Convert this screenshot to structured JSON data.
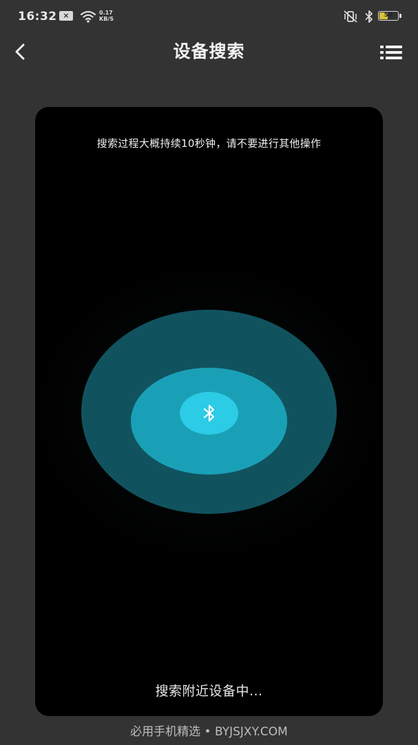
{
  "status_bar": {
    "time": "16:32",
    "notification_badge": "×",
    "net_speed_value": "0.17",
    "net_speed_unit": "KB/S",
    "battery_level": "50",
    "icons": [
      "close-notification-icon",
      "wifi-icon",
      "vibrate-off-icon",
      "bluetooth-icon",
      "battery-icon"
    ]
  },
  "header": {
    "title": "设备搜索",
    "back_icon": "chevron-left-icon",
    "menu_icon": "list-menu-icon"
  },
  "search": {
    "hint": "搜索过程大概持续10秒钟，请不要进行其他操作",
    "status": "搜索附近设备中...",
    "center_icon": "bluetooth-icon"
  },
  "colors": {
    "background": "#333333",
    "card": "#000000",
    "ring_outer": "#10535f",
    "ring_middle": "#1aa0b6",
    "ring_inner": "#2ccbe6",
    "battery": "#d9c23a"
  },
  "watermark": "必用手机精选 • BYJSJXY.COM"
}
